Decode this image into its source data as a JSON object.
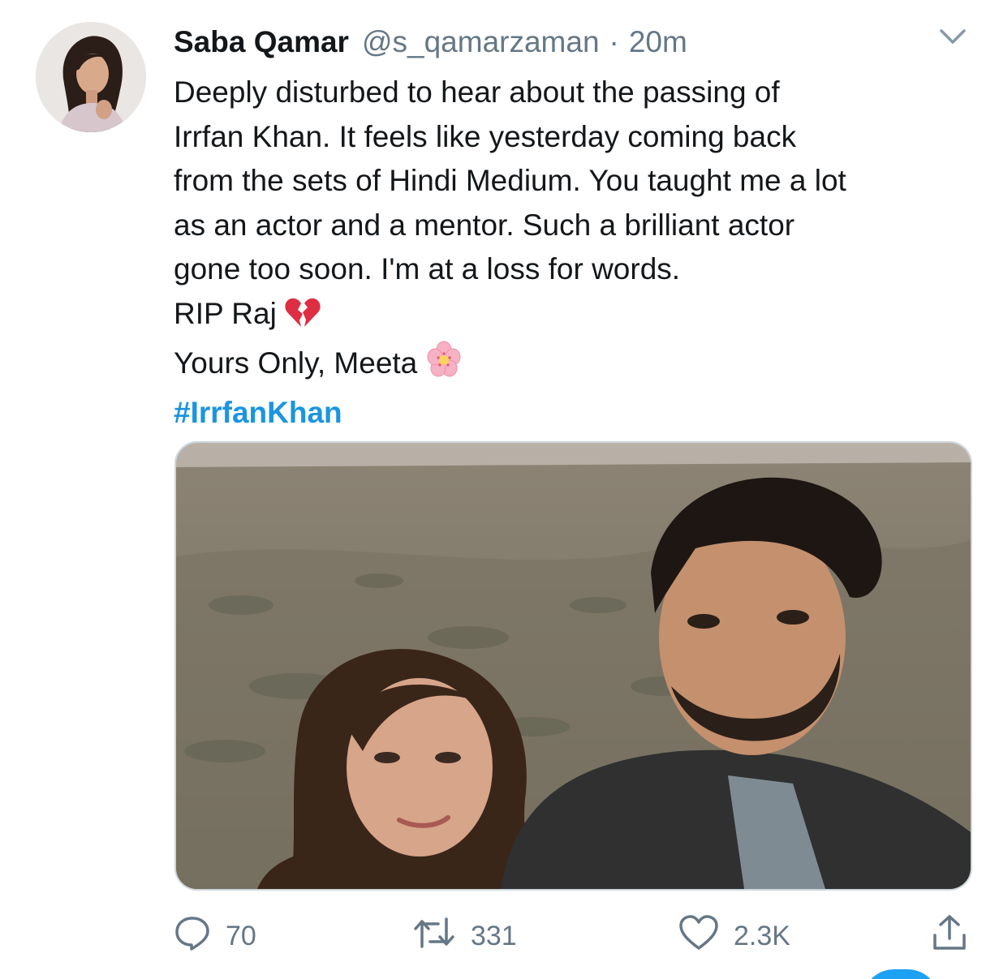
{
  "tweet": {
    "author_name": "Saba Qamar",
    "handle": "@s_qamarzaman",
    "separator": "·",
    "timestamp": "20m",
    "text_lines": [
      "Deeply disturbed to hear about the passing of",
      "Irrfan Khan. It feels like yesterday coming back",
      "from the sets of Hindi Medium. You taught me a lot",
      "as an actor and a mentor. Such a brilliant actor",
      "gone too soon. I'm at a loss for words.",
      "RIP Raj",
      "Yours Only, Meeta"
    ],
    "hashtag": "#IrrfanKhan",
    "emoji_rip": "broken-heart-emoji",
    "emoji_meeta": "cherry-blossom-emoji"
  },
  "actions": {
    "reply_count": "70",
    "retweet_count": "331",
    "like_count": "2.3K"
  },
  "icons": {
    "reply": "speech-bubble-icon",
    "retweet": "retweet-icon",
    "like": "heart-icon",
    "share": "share-icon",
    "more": "chevron-down-icon"
  },
  "colors": {
    "text": "#14171a",
    "muted": "#657786",
    "link": "#1b95e0",
    "border": "#ccd6dd",
    "accent": "#1da1f2"
  }
}
